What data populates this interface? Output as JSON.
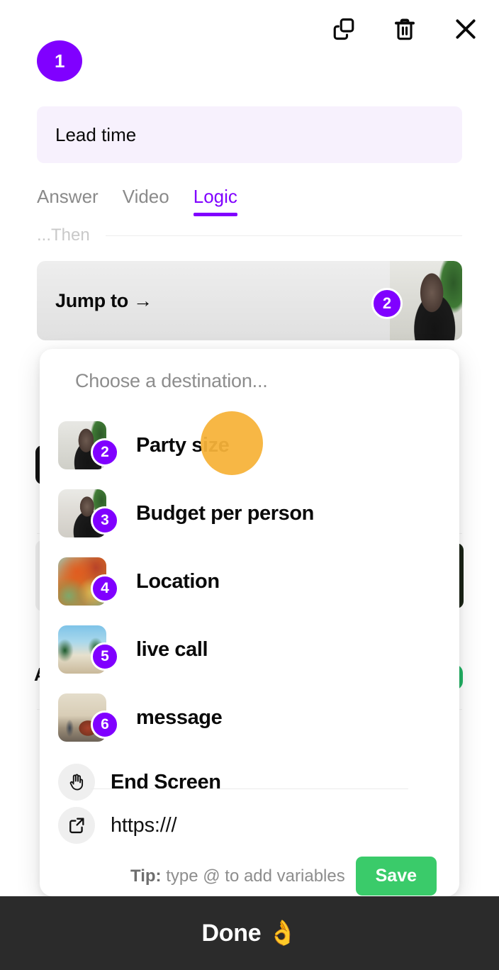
{
  "header": {
    "icons": [
      {
        "name": "duplicate-icon",
        "label": "Duplicate"
      },
      {
        "name": "trash-icon",
        "label": "Delete"
      },
      {
        "name": "close-icon",
        "label": "Close"
      }
    ]
  },
  "step": {
    "number": "1",
    "title": "Lead time",
    "accent_color": "#8000ff"
  },
  "tabs": [
    {
      "label": "Answer",
      "active": false
    },
    {
      "label": "Video",
      "active": false
    },
    {
      "label": "Logic",
      "active": true
    }
  ],
  "logic": {
    "then_label": "...Then",
    "jump_label": "Jump to →",
    "jump_target_number": "2"
  },
  "popup": {
    "title": "Choose a destination...",
    "destinations": [
      {
        "number": "2",
        "label": "Party size",
        "thumb": "person"
      },
      {
        "number": "3",
        "label": "Budget per person",
        "thumb": "person2"
      },
      {
        "number": "4",
        "label": "Location",
        "thumb": "map"
      },
      {
        "number": "5",
        "label": "live call",
        "thumb": "beach"
      },
      {
        "number": "6",
        "label": "message",
        "thumb": "desert"
      }
    ],
    "end_screen": {
      "label": "End Screen",
      "icon": "waving-hand-icon"
    },
    "url": {
      "value": "https:///",
      "icon": "external-link-icon"
    },
    "tip": {
      "prefix": "Tip:",
      "text": " type @ to add variables"
    },
    "save_label": "Save",
    "save_color": "#3acb6a"
  },
  "bottom_bar": {
    "label": "Done 👌",
    "background": "#2b2b2b"
  }
}
